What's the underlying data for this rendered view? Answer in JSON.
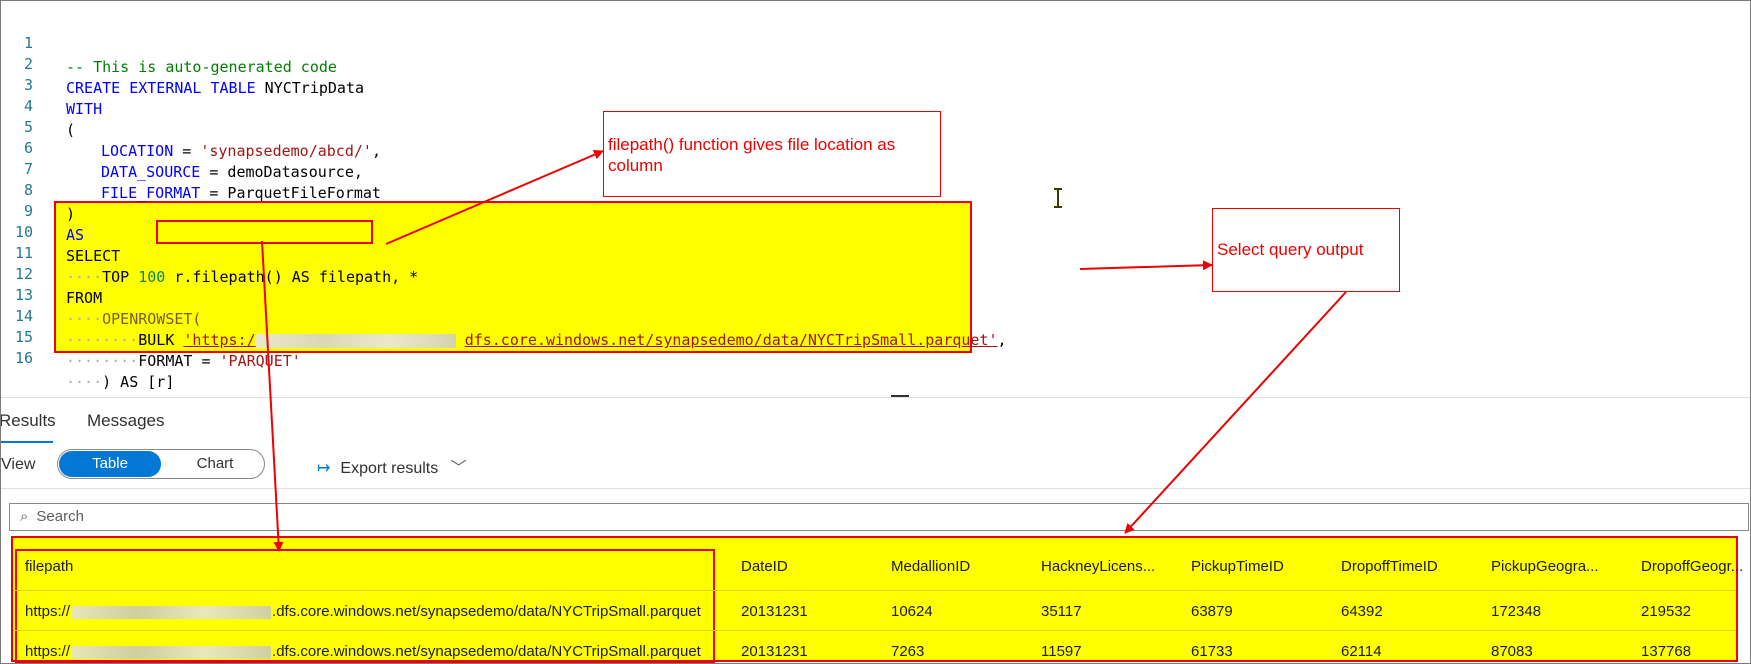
{
  "editor": {
    "lines": [
      {
        "n": "1"
      },
      {
        "n": "2"
      },
      {
        "n": "3"
      },
      {
        "n": "4"
      },
      {
        "n": "5"
      },
      {
        "n": "6"
      },
      {
        "n": "7"
      },
      {
        "n": "8"
      },
      {
        "n": "9"
      },
      {
        "n": "10"
      },
      {
        "n": "11"
      },
      {
        "n": "12"
      },
      {
        "n": "13"
      },
      {
        "n": "14"
      },
      {
        "n": "15"
      },
      {
        "n": "16"
      }
    ],
    "code": {
      "l1": "-- This is auto-generated code",
      "l2_kw": "CREATE EXTERNAL TABLE",
      "l2_rest": " NYCTripData",
      "l3": "WITH",
      "l4": "(",
      "l5_key": "LOCATION",
      "l5_eq": " = ",
      "l5_val": "'synapsedemo/abcd/'",
      "l5_end": ",",
      "l6_key": "DATA_SOURCE",
      "l6_rest": " = demoDatasource,",
      "l7_key": "FILE_FORMAT",
      "l7_rest": " = ParquetFileFormat",
      "l8": ")",
      "l9": "AS",
      "l10": "SELECT",
      "l11_top": "TOP",
      "l11_num": "100",
      "l11_expr": "r.filepath() AS filepath",
      "l11_end": ", *",
      "l12": "FROM",
      "l13_fn": "OPENROWSET(",
      "l14_kw": "BULK",
      "l14_url_start": "'https:/",
      "l14_url_end": "dfs.core.windows.net/synapsedemo/data/NYCTripSmall.parquet'",
      "l14_end": ",",
      "l15_kw": "FORMAT",
      "l15_eq": " = ",
      "l15_val": "'PARQUET'",
      "l16": ") AS [r]"
    }
  },
  "annotations": {
    "filepath_note": "filepath() function gives file location as column",
    "select_note": "Select query output"
  },
  "results": {
    "tabs": [
      "Results",
      "Messages"
    ],
    "view_label": "View",
    "toggle": {
      "table": "Table",
      "chart": "Chart",
      "selected": "Table"
    },
    "export_label": "Export results",
    "search_placeholder": "Search",
    "columns": [
      "filepath",
      "DateID",
      "MedallionID",
      "HackneyLicens...",
      "PickupTimeID",
      "DropoffTimeID",
      "PickupGeogra...",
      "DropoffGeogr..."
    ],
    "rows": [
      {
        "fp_start": "https://",
        "fp_end": ".dfs.core.windows.net/synapsedemo/data/NYCTripSmall.parquet",
        "DateID": "20131231",
        "MedallionID": "10624",
        "Hackney": "35117",
        "Pickup": "63879",
        "Dropoff": "64392",
        "PickupGeo": "172348",
        "DropoffGeo": "219532"
      },
      {
        "fp_start": "https://",
        "fp_end": ".dfs.core.windows.net/synapsedemo/data/NYCTripSmall.parquet",
        "DateID": "20131231",
        "MedallionID": "7263",
        "Hackney": "11597",
        "Pickup": "61733",
        "Dropoff": "62114",
        "PickupGeo": "87083",
        "DropoffGeo": "137768"
      }
    ]
  },
  "colors": {
    "highlight": "#ffff00",
    "annotation_red": "#ee0000",
    "accent": "#0078d4"
  }
}
